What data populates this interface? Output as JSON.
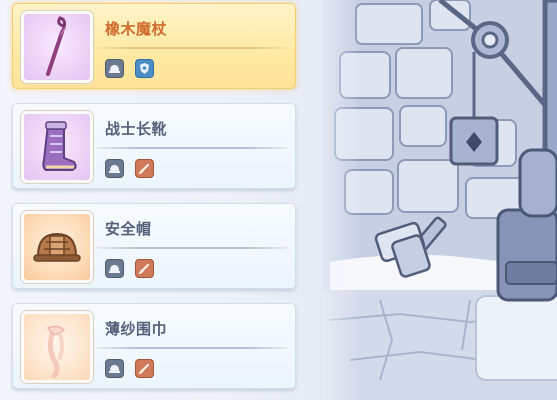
{
  "items": [
    {
      "name": "橡木魔杖",
      "selected": true,
      "thumb_icon": "wand-icon",
      "thumb_tint": "purple",
      "badges": [
        {
          "icon": "helmet-rank-icon",
          "color": "#6b7a90"
        },
        {
          "icon": "shield-type-icon",
          "color": "#4a8ec6"
        }
      ]
    },
    {
      "name": "战士长靴",
      "selected": false,
      "thumb_icon": "boot-icon",
      "thumb_tint": "purple",
      "badges": [
        {
          "icon": "helmet-rank-icon",
          "color": "#6b7a90"
        },
        {
          "icon": "sword-type-icon",
          "color": "#d07a5a"
        }
      ]
    },
    {
      "name": "安全帽",
      "selected": false,
      "thumb_icon": "hardhat-icon",
      "thumb_tint": "orange",
      "badges": [
        {
          "icon": "helmet-rank-icon",
          "color": "#6b7a90"
        },
        {
          "icon": "sword-type-icon",
          "color": "#d07a5a"
        }
      ]
    },
    {
      "name": "薄纱围巾",
      "selected": false,
      "thumb_icon": "scarf-icon",
      "thumb_tint": "orange-faint",
      "badges": [
        {
          "icon": "helmet-rank-icon",
          "color": "#6b7a90"
        },
        {
          "icon": "sword-type-icon",
          "color": "#d07a5a"
        }
      ]
    }
  ]
}
